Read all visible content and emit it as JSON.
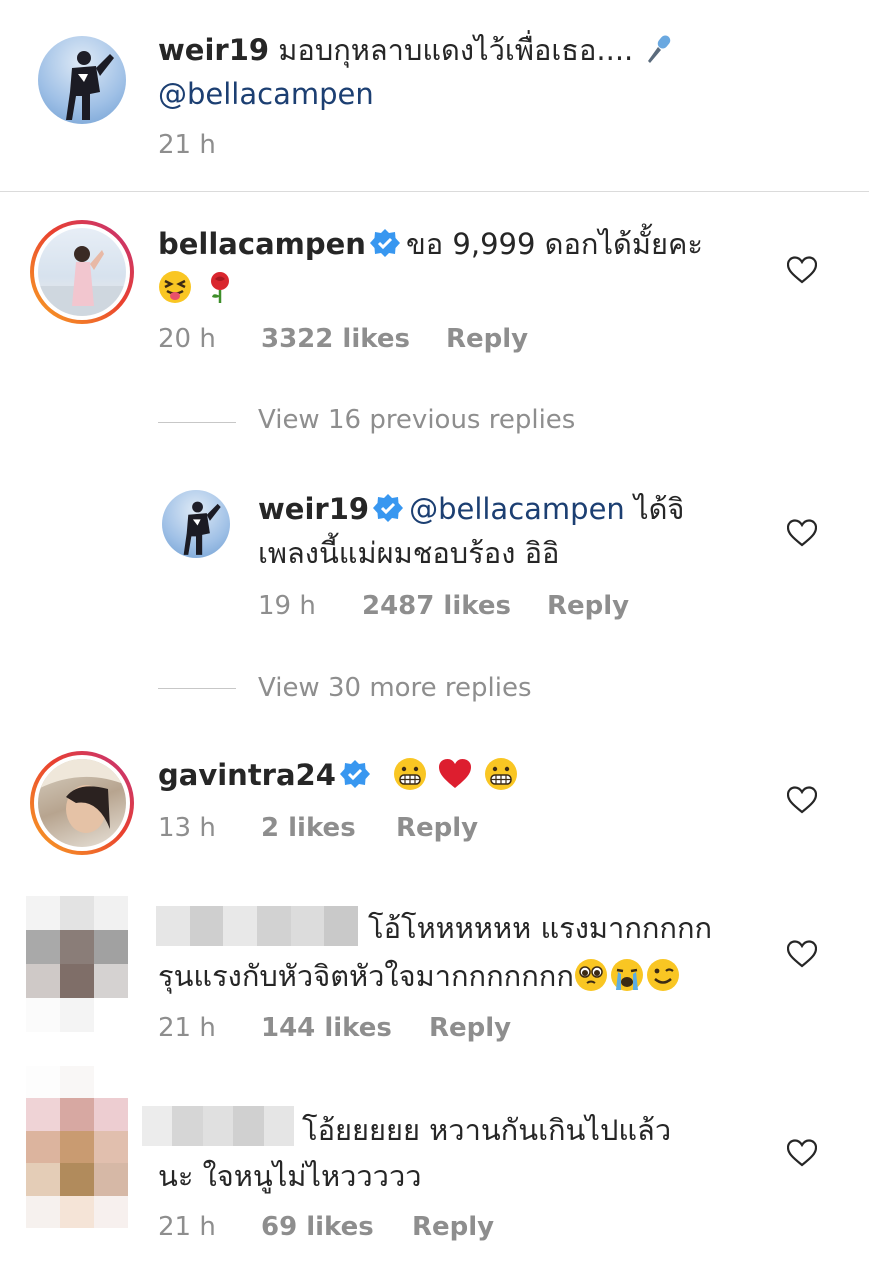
{
  "colors": {
    "accent_mention": "#1c3f72",
    "meta_gray": "#8e8e8e",
    "badge_blue": "#3897f0",
    "heart_outline": "#262626"
  },
  "post": {
    "username": "weir19",
    "caption": "มอบกุหลาบแดงไว้เพื่อเธอ....",
    "caption_icon": "microphone-icon",
    "mention": "@bellacampen",
    "time": "21 h"
  },
  "comments": [
    {
      "username": "bellacampen",
      "verified": true,
      "text": "ขอ 9,999 ดอกได้มั้ยคะ",
      "emoji": [
        "squinting-tongue-emoji",
        "rose-emoji"
      ],
      "time": "20 h",
      "likes": "3322 likes",
      "reply": "Reply",
      "view_previous": "View 16 previous replies",
      "reply_item": {
        "username": "weir19",
        "verified": true,
        "mention": "@bellacampen",
        "text_line1": "ได้จิ",
        "text_line2": "เพลงนี้แม่ผมชอบร้อง อิอิ",
        "time": "19 h",
        "likes": "2487 likes",
        "reply": "Reply"
      },
      "view_more": "View 30 more replies"
    },
    {
      "username": "gavintra24",
      "verified": true,
      "emoji": [
        "grimacing-emoji",
        "red-heart-emoji",
        "grimacing-emoji"
      ],
      "time": "13 h",
      "likes": "2 likes",
      "reply": "Reply"
    },
    {
      "username_hidden": true,
      "text_line1": "โอ้โหหหหหห แรงมากกกกก",
      "text_line2": "รุนแรงกับหัวจิตหัวใจมากกกกกกก",
      "emoji": [
        "pleading-face-emoji",
        "loudly-crying-emoji",
        "winking-emoji"
      ],
      "time": "21 h",
      "likes": "144 likes",
      "reply": "Reply"
    },
    {
      "username_hidden": true,
      "text_line1": "โอ้ยยยยย หวานกันเกินไปแล้ว",
      "text_line2": "นะ ใจหนูไม่ไหววววว",
      "time": "21 h",
      "likes": "69 likes",
      "reply": "Reply"
    }
  ]
}
